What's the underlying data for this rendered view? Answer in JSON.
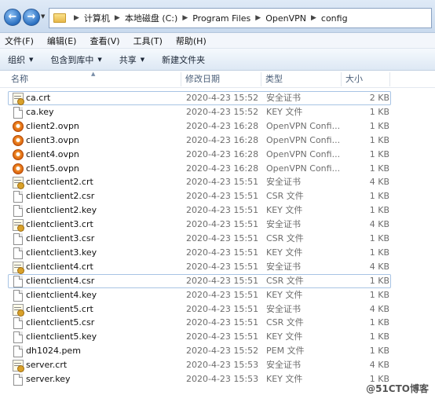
{
  "address": {
    "crumbs": [
      "计算机",
      "本地磁盘 (C:)",
      "Program Files",
      "OpenVPN",
      "config"
    ],
    "separator": "▶"
  },
  "menu": [
    "文件(F)",
    "编辑(E)",
    "查看(V)",
    "工具(T)",
    "帮助(H)"
  ],
  "commands": [
    {
      "label": "组织",
      "dropdown": true
    },
    {
      "label": "包含到库中",
      "dropdown": true
    },
    {
      "label": "共享",
      "dropdown": true
    },
    {
      "label": "新建文件夹",
      "dropdown": false
    }
  ],
  "columns": {
    "name": "名称",
    "date": "修改日期",
    "type": "类型",
    "size": "大小"
  },
  "files": [
    {
      "name": "ca.crt",
      "date": "2020-4-23 15:52",
      "type": "安全证书",
      "size": "2 KB",
      "icon": "cert"
    },
    {
      "name": "ca.key",
      "date": "2020-4-23 15:52",
      "type": "KEY 文件",
      "size": "1 KB",
      "icon": "doc"
    },
    {
      "name": "client2.ovpn",
      "date": "2020-4-23 16:28",
      "type": "OpenVPN Confi...",
      "size": "1 KB",
      "icon": "ovpn"
    },
    {
      "name": "client3.ovpn",
      "date": "2020-4-23 16:28",
      "type": "OpenVPN Confi...",
      "size": "1 KB",
      "icon": "ovpn"
    },
    {
      "name": "client4.ovpn",
      "date": "2020-4-23 16:28",
      "type": "OpenVPN Confi...",
      "size": "1 KB",
      "icon": "ovpn"
    },
    {
      "name": "client5.ovpn",
      "date": "2020-4-23 16:28",
      "type": "OpenVPN Confi...",
      "size": "1 KB",
      "icon": "ovpn"
    },
    {
      "name": "clientclient2.crt",
      "date": "2020-4-23 15:51",
      "type": "安全证书",
      "size": "4 KB",
      "icon": "cert"
    },
    {
      "name": "clientclient2.csr",
      "date": "2020-4-23 15:51",
      "type": "CSR 文件",
      "size": "1 KB",
      "icon": "doc"
    },
    {
      "name": "clientclient2.key",
      "date": "2020-4-23 15:51",
      "type": "KEY 文件",
      "size": "1 KB",
      "icon": "doc"
    },
    {
      "name": "clientclient3.crt",
      "date": "2020-4-23 15:51",
      "type": "安全证书",
      "size": "4 KB",
      "icon": "cert"
    },
    {
      "name": "clientclient3.csr",
      "date": "2020-4-23 15:51",
      "type": "CSR 文件",
      "size": "1 KB",
      "icon": "doc"
    },
    {
      "name": "clientclient3.key",
      "date": "2020-4-23 15:51",
      "type": "KEY 文件",
      "size": "1 KB",
      "icon": "doc"
    },
    {
      "name": "clientclient4.crt",
      "date": "2020-4-23 15:51",
      "type": "安全证书",
      "size": "4 KB",
      "icon": "cert"
    },
    {
      "name": "clientclient4.csr",
      "date": "2020-4-23 15:51",
      "type": "CSR 文件",
      "size": "1 KB",
      "icon": "doc"
    },
    {
      "name": "clientclient4.key",
      "date": "2020-4-23 15:51",
      "type": "KEY 文件",
      "size": "1 KB",
      "icon": "doc"
    },
    {
      "name": "clientclient5.crt",
      "date": "2020-4-23 15:51",
      "type": "安全证书",
      "size": "4 KB",
      "icon": "cert"
    },
    {
      "name": "clientclient5.csr",
      "date": "2020-4-23 15:51",
      "type": "CSR 文件",
      "size": "1 KB",
      "icon": "doc"
    },
    {
      "name": "clientclient5.key",
      "date": "2020-4-23 15:51",
      "type": "KEY 文件",
      "size": "1 KB",
      "icon": "doc"
    },
    {
      "name": "dh1024.pem",
      "date": "2020-4-23 15:52",
      "type": "PEM 文件",
      "size": "1 KB",
      "icon": "doc"
    },
    {
      "name": "server.crt",
      "date": "2020-4-23 15:53",
      "type": "安全证书",
      "size": "4 KB",
      "icon": "cert"
    },
    {
      "name": "server.key",
      "date": "2020-4-23 15:53",
      "type": "KEY 文件",
      "size": "1 KB",
      "icon": "doc"
    }
  ],
  "selected_rows": [
    0,
    13
  ],
  "watermark": "@51CTO博客"
}
